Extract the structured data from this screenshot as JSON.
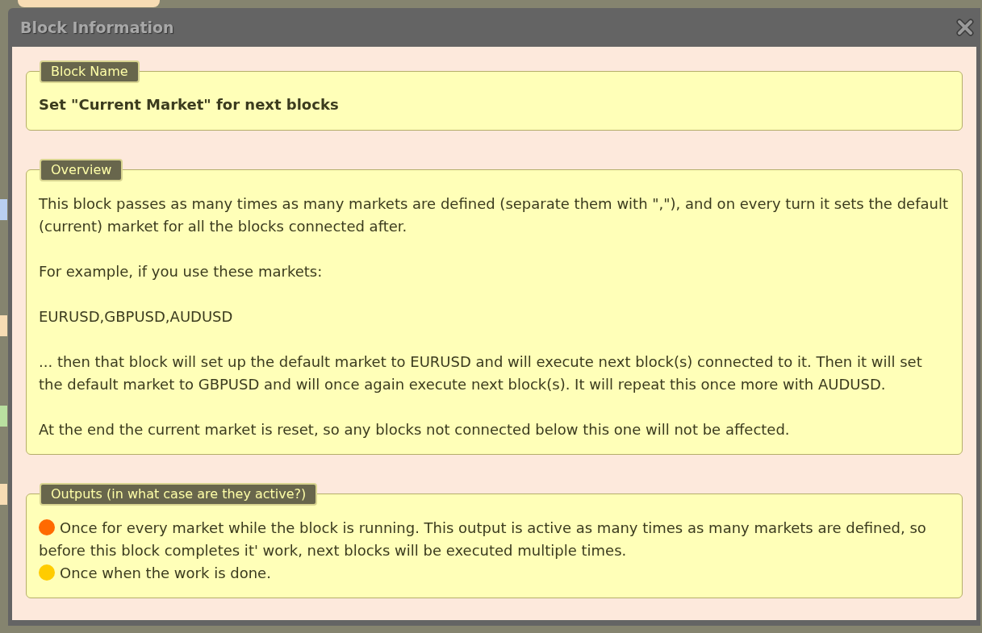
{
  "background": {
    "labels": [
      {
        "color": "#f7dcb4"
      },
      {
        "color": "#b9cff0"
      },
      {
        "color": "#f7dcb4"
      },
      {
        "color": "#b9e0a0"
      },
      {
        "color": "#f7dcb4"
      }
    ]
  },
  "window": {
    "title": "Block Information"
  },
  "block_name": {
    "legend": "Block Name",
    "value": "Set \"Current Market\" for next blocks"
  },
  "overview": {
    "legend": "Overview",
    "paragraphs": [
      "This block passes as many times as many markets are defined (separate them with \",\"), and on every turn it sets the default (current) market for all the blocks connected after.",
      "For example, if you use these markets:",
      "EURUSD,GBPUSD,AUDUSD",
      "... then that block will set up the default market to EURUSD and will execute next block(s) connected to it. Then it will set the default market to GBPUSD and will once again execute next block(s). It will repeat this once more with AUDUSD.",
      "At the end the current market is reset, so any blocks not connected below this one will not be affected."
    ]
  },
  "outputs": {
    "legend": "Outputs (in what case are they active?)",
    "items": [
      {
        "color": "#ff6a00",
        "text": "Once for every market while the block is running. This output is active as many times as many markets are defined, so before this block completes it' work, next blocks will be executed multiple times."
      },
      {
        "color": "#ffcc00",
        "text": "Once when the work is done."
      }
    ]
  }
}
